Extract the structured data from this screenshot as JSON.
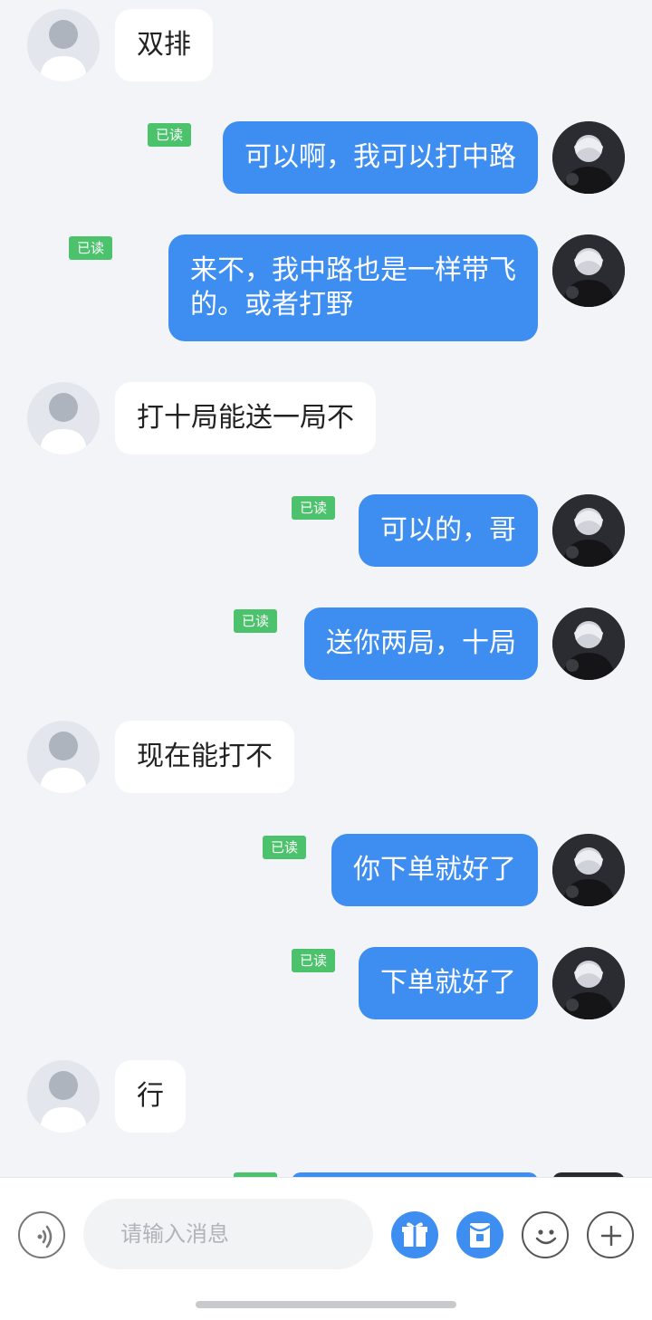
{
  "conversation": {
    "messages": [
      {
        "side": "left",
        "text": "双排"
      },
      {
        "side": "right",
        "text": "可以啊，我可以打中路",
        "read": "已读"
      },
      {
        "side": "right",
        "text": "来不，我中路也是一样带飞\n的。或者打野",
        "read": "已读"
      },
      {
        "side": "left",
        "text": "打十局能送一局不"
      },
      {
        "side": "right",
        "text": "可以的，哥",
        "read": "已读"
      },
      {
        "side": "right",
        "text": "送你两局，十局",
        "read": "已读"
      },
      {
        "side": "left",
        "text": "现在能打不"
      },
      {
        "side": "right",
        "text": "你下单就好了",
        "read": "已读"
      },
      {
        "side": "right",
        "text": "下单就好了",
        "read": "已读"
      },
      {
        "side": "left",
        "text": "行"
      }
    ]
  },
  "input_bar": {
    "placeholder": "请输入消息",
    "voice_icon": "voice-icon",
    "gift_icon": "gift-icon",
    "red_packet_icon": "red-packet-icon",
    "emoji_icon": "emoji-icon",
    "plus_icon": "plus-icon"
  },
  "colors": {
    "background": "#f2f4f7",
    "sent_bubble": "#3d8ef0",
    "received_bubble": "#ffffff",
    "read_badge": "#4cc26d"
  }
}
